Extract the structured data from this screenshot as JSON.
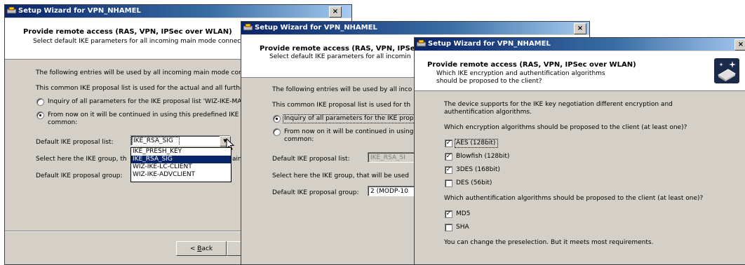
{
  "window_title": "Setup Wizard for VPN_NHAMEL",
  "close_label": "×",
  "w1": {
    "heading": "Provide remote access (RAS, VPN, IPSec over WLAN)",
    "subheading": "Select default IKE parameters for all incoming main mode connec",
    "intro": "The following entries will be used by all incoming main mode conn",
    "proposal_info": "This common IKE proposal list is used for the actual and all furthe",
    "radio1": "Inquiry of all parameters for the IKE proposal list 'WIZ-IKE-MA",
    "radio2_line1": "From now on it will be continued in using this predefined IKE p",
    "radio2_line2": "common:",
    "proposal_list_label": "Default IKE proposal list:",
    "proposal_list_value": "IKE_RSA_SIG",
    "group_info": "Select here the IKE group, th",
    "group_info_tail": "ain",
    "group_label": "Default IKE proposal group:",
    "dropdown_options": [
      "IKE_PRESH_KEY",
      "IKE_RSA_SIG",
      "WIZ-IKE-LC-CLIENT",
      "WIZ-IKE-ADVCLIENT"
    ],
    "dropdown_selected_index": 1,
    "back_prefix": "< ",
    "back_key": "B",
    "back_rest": "ack"
  },
  "w2": {
    "heading": "Provide remote access (RAS, VPN, IPSe",
    "subheading": "Select default IKE parameters for all incomin",
    "intro": "The following entries will be used by all inco",
    "proposal_info": "This common IKE proposal list is used for th",
    "radio1": "Inquiry of all parameters for the IKE prop",
    "radio2_line1": "From now on it will be continued in using",
    "radio2_line2": "common:",
    "proposal_list_label": "Default IKE proposal list:",
    "proposal_list_value": "IKE_RSA_SI",
    "group_info": "Select here the IKE group, that will be used",
    "group_label": "Default IKE proposal group:",
    "group_value": "2 (MODP-10"
  },
  "w3": {
    "heading": "Provide remote access (RAS, VPN, IPSec over WLAN)",
    "subheading_line1": "Which IKE encryption and authentification algorithms",
    "subheading_line2": "should be proposed to the client?",
    "intro_line1": "The device supports for the IKE key negotiation different encryption and",
    "intro_line2": "authentification algorithms.",
    "enc_question": "Which encryption algorithms should be proposed to the client (at least one)?",
    "encryption": [
      {
        "label": "AES (128bit)",
        "checked": true
      },
      {
        "label": "Blowfish (128bit)",
        "checked": true
      },
      {
        "label": "3DES (168bit)",
        "checked": true
      },
      {
        "label": "DES (56bit)",
        "checked": false
      }
    ],
    "auth_question": "Which authentification algorithms should be proposed to the client (at least one)?",
    "authentication": [
      {
        "label": "MD5",
        "checked": true
      },
      {
        "label": "SHA",
        "checked": false
      }
    ],
    "footer": "You can change the preselection. But it meets most requirements."
  },
  "colors": {
    "titlebar": "#0a246a",
    "face": "#d4d0c8",
    "selection": "#0a246a"
  }
}
